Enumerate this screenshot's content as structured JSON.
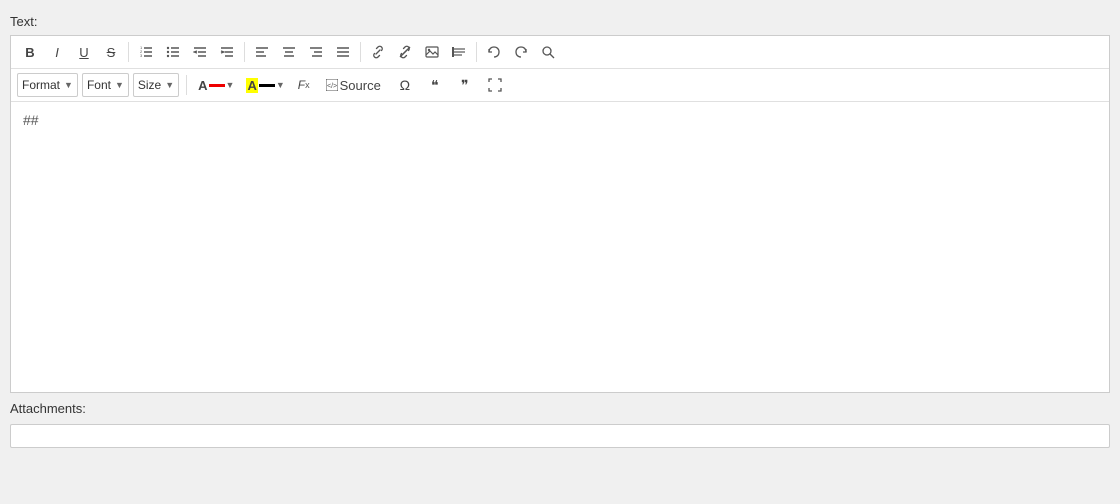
{
  "label": "Text:",
  "attachments_label": "Attachments:",
  "toolbar": {
    "bold": "B",
    "italic": "I",
    "underline": "U",
    "strikethrough": "S",
    "ordered_list": "ol",
    "unordered_list": "ul",
    "indent_decrease": "←",
    "indent_increase": "→",
    "align_left": "⬅",
    "align_center": "☰",
    "align_right": "☷",
    "align_justify": "≡",
    "link": "🔗",
    "unlink": "🔗x",
    "image": "🖼",
    "blockquote": "❝",
    "undo": "↩",
    "redo": "↪",
    "find": "🔍",
    "format_label": "Format",
    "font_label": "Font",
    "size_label": "Size",
    "font_color": "A",
    "bg_color": "A",
    "clear_format": "Fx",
    "source_label": "Source",
    "omega": "Ω",
    "quote_open": "❝",
    "quote_close": "❞",
    "fullscreen": "⛶"
  },
  "editor_content": "##",
  "editor_placeholder": ""
}
